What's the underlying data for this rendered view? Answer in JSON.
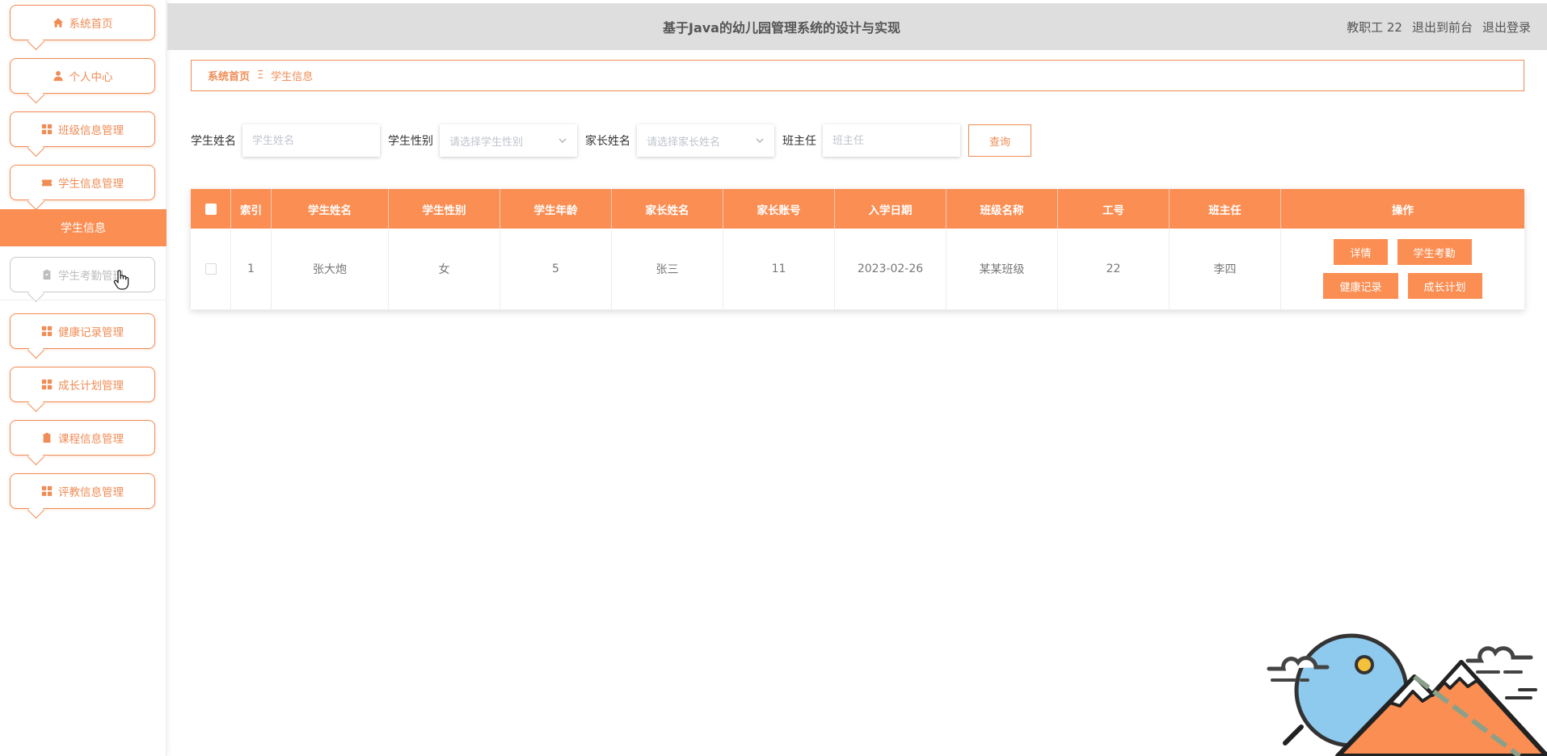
{
  "header": {
    "title": "基于Java的幼儿园管理系统的设计与实现",
    "user": "教职工 22",
    "to_front": "退出到前台",
    "logout": "退出登录"
  },
  "sidebar": {
    "items": [
      {
        "label": "系统首页",
        "icon": "home-icon"
      },
      {
        "label": "个人中心",
        "icon": "person-icon"
      },
      {
        "label": "班级信息管理",
        "icon": "grid-icon"
      },
      {
        "label": "学生信息管理",
        "icon": "ticket-icon"
      },
      {
        "label": "学生考勤管理",
        "icon": "clipboard-icon"
      },
      {
        "label": "健康记录管理",
        "icon": "grid-icon"
      },
      {
        "label": "成长计划管理",
        "icon": "grid-icon"
      },
      {
        "label": "课程信息管理",
        "icon": "clipboard-icon"
      },
      {
        "label": "评教信息管理",
        "icon": "grid-icon"
      }
    ],
    "active_sub": "学生信息"
  },
  "breadcrumb": {
    "home": "系统首页",
    "sep": "Ξ",
    "current": "学生信息"
  },
  "search": {
    "name_label": "学生姓名",
    "name_placeholder": "学生姓名",
    "gender_label": "学生性别",
    "gender_placeholder": "请选择学生性别",
    "parent_label": "家长姓名",
    "parent_placeholder": "请选择家长姓名",
    "teacher_label": "班主任",
    "teacher_placeholder": "班主任",
    "query_button": "查询"
  },
  "table": {
    "headers": [
      "索引",
      "学生姓名",
      "学生性别",
      "学生年龄",
      "家长姓名",
      "家长账号",
      "入学日期",
      "班级名称",
      "工号",
      "班主任",
      "操作"
    ],
    "rows": [
      [
        "1",
        "张大炮",
        "女",
        "5",
        "张三",
        "11",
        "2023-02-26",
        "某某班级",
        "22",
        "李四"
      ]
    ],
    "actions": {
      "detail": "详情",
      "attendance": "学生考勤",
      "health": "健康记录",
      "growth": "成长计划"
    }
  },
  "colors": {
    "accent": "#fb8e53",
    "accent_border": "#f08c55",
    "header_bg": "#dedede"
  }
}
